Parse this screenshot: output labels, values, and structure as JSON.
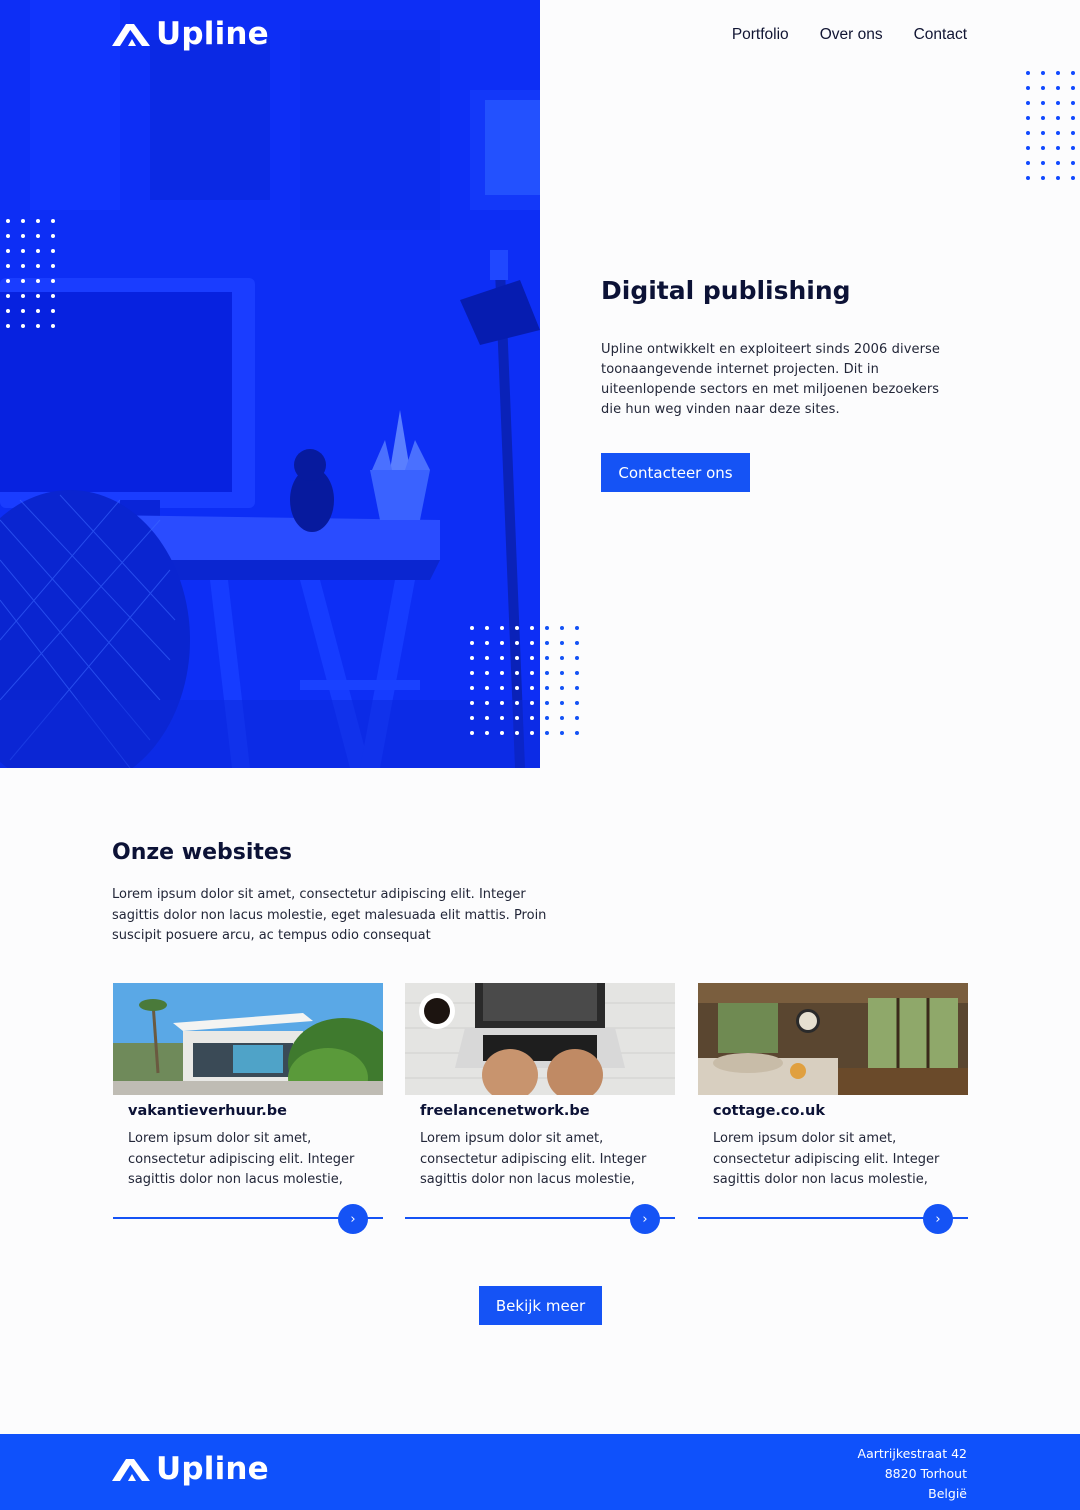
{
  "brand": {
    "name": "Upline"
  },
  "nav": {
    "items": [
      {
        "label": "Portfolio"
      },
      {
        "label": "Over ons"
      },
      {
        "label": "Contact"
      }
    ]
  },
  "hero": {
    "title": "Digital publishing",
    "text": "Upline ontwikkelt en exploiteert sinds 2006 diverse toonaangevende internet projecten. Dit in uiteenlopende sectors en met miljoenen bezoekers die hun weg vinden naar deze sites.",
    "cta": "Contacteer ons"
  },
  "websites": {
    "title": "Onze websites",
    "text": "Lorem ipsum dolor sit amet, consectetur adipiscing elit. Integer sagittis dolor non lacus molestie, eget malesuada elit mattis. Proin suscipit posuere arcu, ac tempus odio consequat",
    "cards": [
      {
        "title": "vakantieverhuur.be",
        "text": "Lorem ipsum dolor sit amet, consectetur adipiscing elit. Integer sagittis dolor non lacus molestie,"
      },
      {
        "title": "freelancenetwork.be",
        "text": "Lorem ipsum dolor sit amet, consectetur adipiscing elit. Integer sagittis dolor non lacus molestie,"
      },
      {
        "title": "cottage.co.uk",
        "text": "Lorem ipsum dolor sit amet, consectetur adipiscing elit. Integer sagittis dolor non lacus molestie,"
      }
    ],
    "more": "Bekijk meer"
  },
  "footer": {
    "address": {
      "street": "Aartrijkestraat 42",
      "city": "8820 Torhout",
      "country": "België"
    }
  },
  "colors": {
    "accent": "#1553f5",
    "hero_blue": "#0d2cf2",
    "footer_blue": "#0f51fb",
    "heading": "#0c1236"
  },
  "icons": {
    "logo": "upline-logo-icon",
    "card_arrow": "chevron-right-icon"
  }
}
